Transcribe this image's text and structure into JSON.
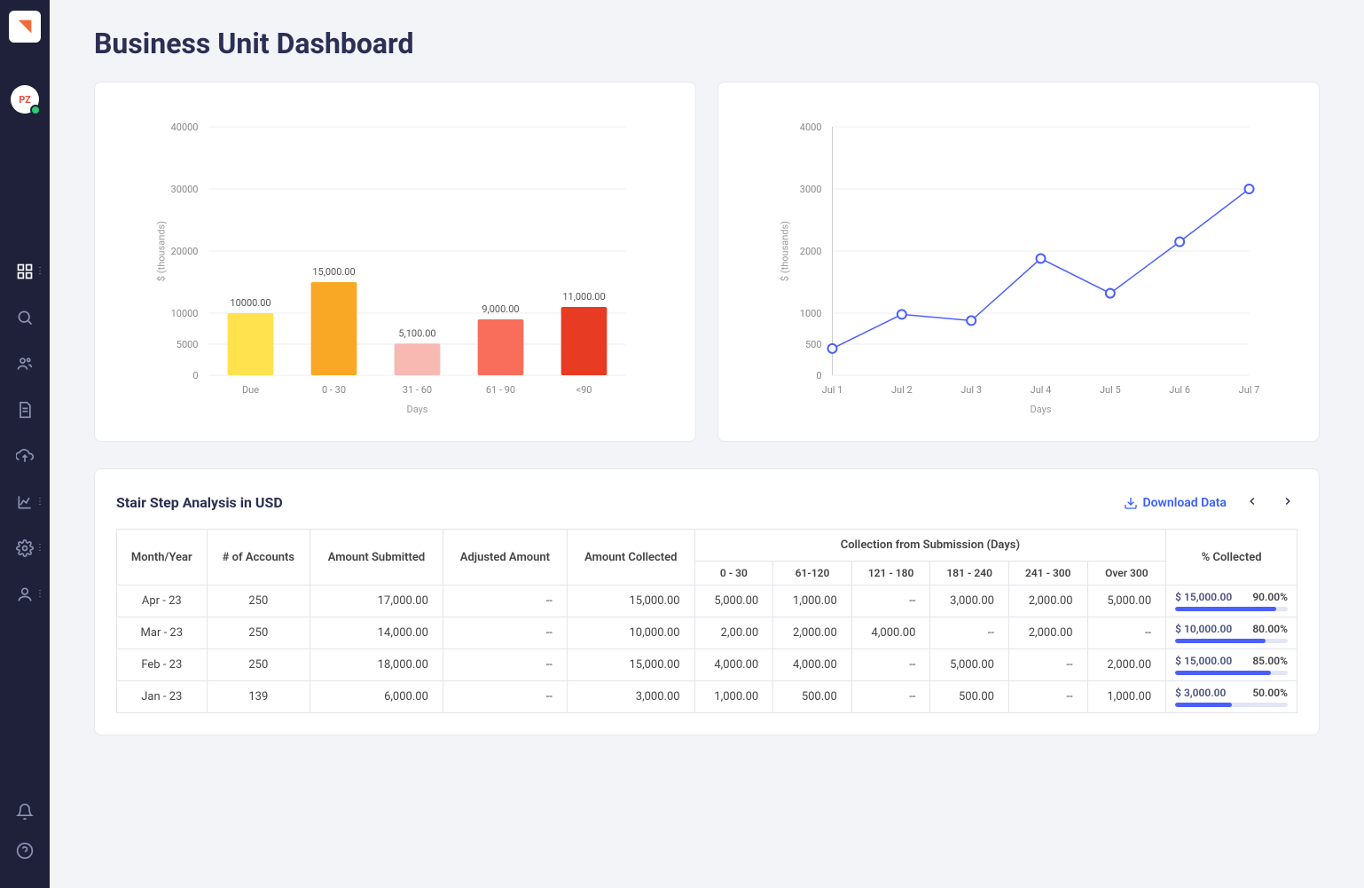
{
  "avatar_initials": "PZ",
  "page_title": "Business Unit Dashboard",
  "bar_chart": {
    "ylabel": "$ (thousands)",
    "xlabel": "Days"
  },
  "line_chart": {
    "ylabel": "$ (thousands)",
    "xlabel": "Days"
  },
  "table_title": "Stair Step Analysis in USD",
  "download_label": "Download Data",
  "headers": {
    "month": "Month/Year",
    "accounts": "# of Accounts",
    "submitted": "Amount Submitted",
    "adjusted": "Adjusted Amount",
    "collected": "Amount Collected",
    "collection_from": "Collection from Submission (Days)",
    "pct": "% Collected"
  },
  "buckets": [
    "0 - 30",
    "61-120",
    "121 - 180",
    "181 - 240",
    "241 - 300",
    "Over 300"
  ],
  "rows": [
    {
      "month": "Apr - 23",
      "accounts": "250",
      "submitted": "17,000.00",
      "adjusted": "--",
      "collected": "15,000.00",
      "b": [
        "5,000.00",
        "1,000.00",
        "--",
        "3,000.00",
        "2,000.00",
        "5,000.00"
      ],
      "pct_amt": "$ 15,000.00",
      "pct": "90.00%",
      "fill": 90
    },
    {
      "month": "Mar - 23",
      "accounts": "250",
      "submitted": "14,000.00",
      "adjusted": "--",
      "collected": "10,000.00",
      "b": [
        "2,00.00",
        "2,000.00",
        "4,000.00",
        "--",
        "2,000.00",
        "--"
      ],
      "pct_amt": "$ 10,000.00",
      "pct": "80.00%",
      "fill": 80
    },
    {
      "month": "Feb - 23",
      "accounts": "250",
      "submitted": "18,000.00",
      "adjusted": "--",
      "collected": "15,000.00",
      "b": [
        "4,000.00",
        "4,000.00",
        "--",
        "5,000.00",
        "--",
        "2,000.00"
      ],
      "pct_amt": "$ 15,000.00",
      "pct": "85.00%",
      "fill": 85
    },
    {
      "month": "Jan - 23",
      "accounts": "139",
      "submitted": "6,000.00",
      "adjusted": "--",
      "collected": "3,000.00",
      "b": [
        "1,000.00",
        "500.00",
        "--",
        "500.00",
        "--",
        "1,000.00"
      ],
      "pct_amt": "$ 3,000.00",
      "pct": "50.00%",
      "fill": 50
    }
  ],
  "chart_data": [
    {
      "type": "bar",
      "xlabel": "Days",
      "ylabel": "$ (thousands)",
      "yticks": [
        0,
        5000,
        10000,
        20000,
        30000,
        40000
      ],
      "categories": [
        "Due",
        "0 - 30",
        "31 - 60",
        "61 - 90",
        "<90"
      ],
      "values": [
        10000,
        15000,
        5100,
        9000,
        11000
      ],
      "labels": [
        "10000.00",
        "15,000.00",
        "5,100.00",
        "9,000.00",
        "11,000.00"
      ],
      "colors": [
        "#ffe24d",
        "#f9a825",
        "#f8b9b3",
        "#f96e5b",
        "#e73b23"
      ]
    },
    {
      "type": "line",
      "xlabel": "Days",
      "ylabel": "$ (thousands)",
      "yticks": [
        0,
        500,
        1000,
        2000,
        3000,
        4000
      ],
      "x": [
        "Jul 1",
        "Jul 2",
        "Jul 3",
        "Jul 4",
        "Jul 5",
        "Jul 6",
        "Jul 7"
      ],
      "values": [
        430,
        980,
        880,
        1880,
        1320,
        2150,
        3000
      ]
    }
  ]
}
